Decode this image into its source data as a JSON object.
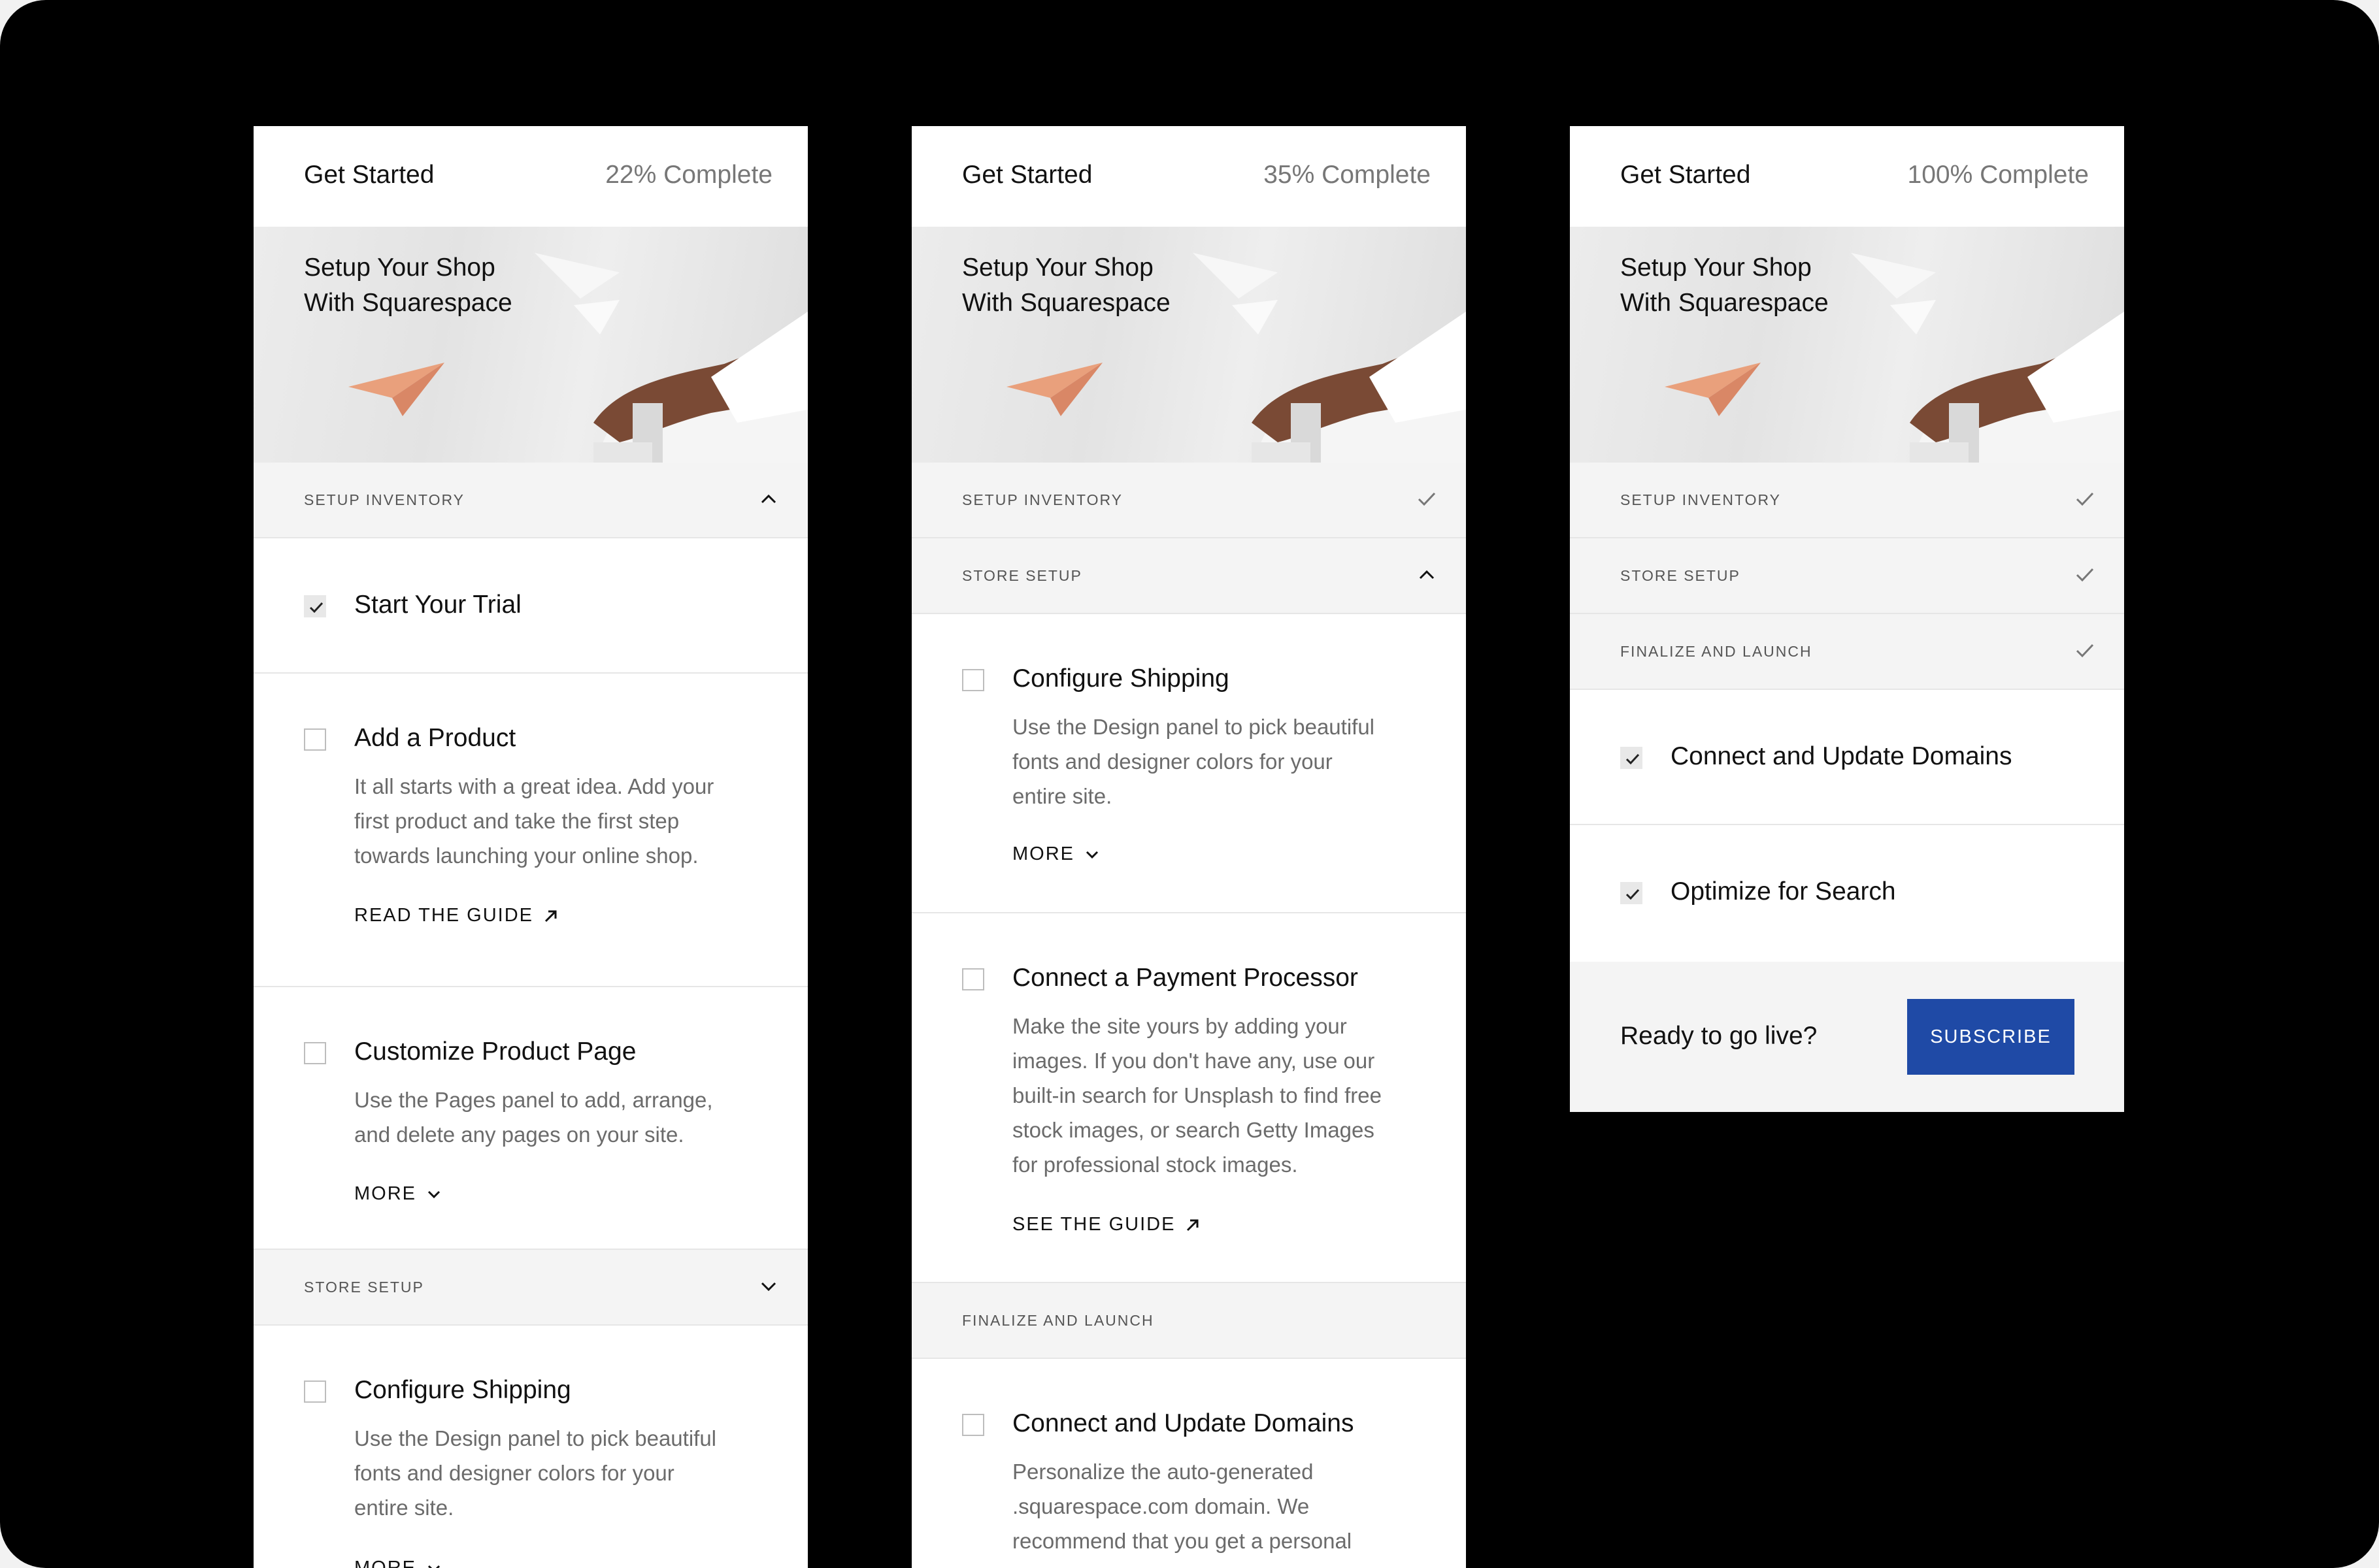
{
  "colors": {
    "accent": "#1f4aa6",
    "background": "#000000",
    "panel": "#ffffff",
    "section": "#f4f4f4"
  },
  "panels": [
    {
      "header": {
        "title": "Get Started",
        "progress": "22% Complete"
      },
      "hero": {
        "line1": "Setup Your Shop",
        "line2": "With Squarespace"
      },
      "sections": {
        "setup_inventory": "SETUP INVENTORY",
        "store_setup": "STORE SETUP"
      },
      "items": [
        {
          "title": "Start Your Trial",
          "checked": true
        },
        {
          "title": "Add a Product",
          "checked": false,
          "desc1": "It all starts with a great idea. Add your",
          "desc2": "first product and take the first step",
          "desc3": "towards launching your online shop.",
          "link": "READ THE GUIDE"
        },
        {
          "title": "Customize Product Page",
          "checked": false,
          "desc1": "Use the Pages panel to add, arrange,",
          "desc2": "and delete any pages on your site.",
          "link": "MORE"
        },
        {
          "title": "Configure Shipping",
          "checked": false,
          "desc1": "Use the Design panel to pick beautiful",
          "desc2": "fonts and designer colors for your",
          "desc3": "entire site.",
          "link": "MORE"
        }
      ]
    },
    {
      "header": {
        "title": "Get Started",
        "progress": "35% Complete"
      },
      "hero": {
        "line1": "Setup Your Shop",
        "line2": "With Squarespace"
      },
      "sections": {
        "setup_inventory": "SETUP INVENTORY",
        "store_setup": "STORE SETUP",
        "finalize": "FINALIZE AND LAUNCH"
      },
      "items": [
        {
          "title": "Configure Shipping",
          "checked": false,
          "desc1": "Use the Design panel to pick beautiful",
          "desc2": "fonts and designer colors for your",
          "desc3": "entire site.",
          "link": "MORE"
        },
        {
          "title": "Connect a Payment Processor",
          "checked": false,
          "desc1": "Make the site yours by adding your",
          "desc2": "images. If you don't have any, use our",
          "desc3": "built-in search for Unsplash to find free",
          "desc4": "stock images, or search Getty Images",
          "desc5": "for professional stock images.",
          "link": "SEE THE GUIDE"
        },
        {
          "title": "Connect and Update Domains",
          "checked": false,
          "desc1": "Personalize the auto-generated",
          "desc2": ".squarespace.com domain. We",
          "desc3": "recommend that you get a personal"
        }
      ]
    },
    {
      "header": {
        "title": "Get Started",
        "progress": "100% Complete"
      },
      "hero": {
        "line1": "Setup Your Shop",
        "line2": "With Squarespace"
      },
      "sections": {
        "setup_inventory": "SETUP INVENTORY",
        "store_setup": "STORE SETUP",
        "finalize": "FINALIZE AND LAUNCH"
      },
      "items": [
        {
          "title": "Connect and Update Domains",
          "checked": true
        },
        {
          "title": "Optimize for Search",
          "checked": true
        }
      ],
      "cta": {
        "text": "Ready to go live?",
        "button": "SUBSCRIBE"
      }
    }
  ]
}
